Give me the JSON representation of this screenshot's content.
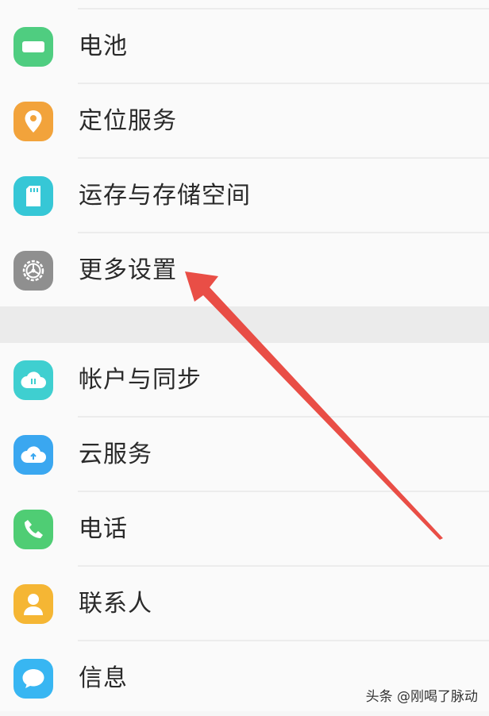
{
  "groups": [
    {
      "items": [
        {
          "label": "电池",
          "icon": "battery-icon",
          "color": "#4fcd80"
        },
        {
          "label": "定位服务",
          "icon": "location-pin-icon",
          "color": "#f2a33b"
        },
        {
          "label": "运存与存储空间",
          "icon": "sd-card-icon",
          "color": "#36c7d6"
        },
        {
          "label": "更多设置",
          "icon": "gear-icon",
          "color": "#8f8f8f"
        }
      ]
    },
    {
      "items": [
        {
          "label": "帐户与同步",
          "icon": "cloud-sync-icon",
          "color": "#3fcfd0"
        },
        {
          "label": "云服务",
          "icon": "cloud-icon",
          "color": "#3aa7f0"
        },
        {
          "label": "电话",
          "icon": "phone-icon",
          "color": "#4fcd74"
        },
        {
          "label": "联系人",
          "icon": "contact-person-icon",
          "color": "#f5b634"
        },
        {
          "label": "信息",
          "icon": "message-bubble-icon",
          "color": "#38b6f2"
        }
      ]
    }
  ],
  "annotation": {
    "arrow_color": "#e8453c",
    "points_to": "更多设置"
  },
  "watermark": "头条 @刚喝了脉动"
}
